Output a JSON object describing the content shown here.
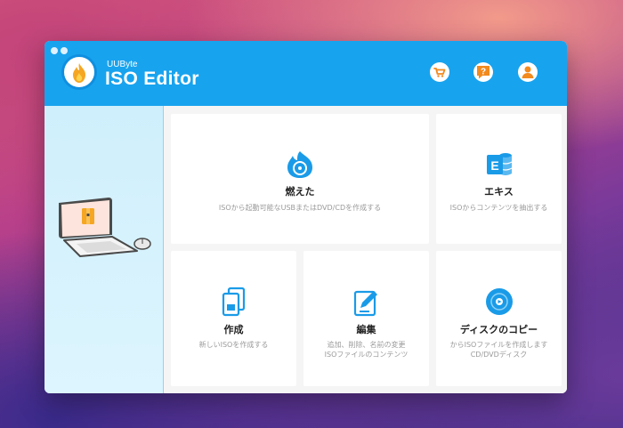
{
  "app": {
    "brand_small": "UUByte",
    "brand_name": "ISO Editor"
  },
  "header_buttons": [
    {
      "name": "cart-icon"
    },
    {
      "name": "help-icon"
    },
    {
      "name": "user-icon"
    }
  ],
  "cards": {
    "burn": {
      "title": "燃えた",
      "desc": "ISOから起動可能なUSBまたはDVD/CDを作成する",
      "icon": "disc-burn-icon"
    },
    "extract": {
      "title": "エキス",
      "desc": "ISOからコンテンツを抽出する",
      "icon": "extract-icon"
    },
    "create": {
      "title": "作成",
      "desc": "新しいISOを作成する",
      "icon": "create-iso-icon"
    },
    "edit": {
      "title": "編集",
      "desc1": "追加、削除、名前の変更",
      "desc2": "ISOファイルのコンテンツ",
      "icon": "edit-icon"
    },
    "copy": {
      "title": "ディスクのコピー",
      "desc1": "からISOファイルを作成します",
      "desc2": "CD/DVDディスク",
      "icon": "disc-copy-icon"
    }
  },
  "colors": {
    "header": "#18a3ee",
    "accent": "#1a9be8",
    "sidebar": "#d6f2fd"
  }
}
